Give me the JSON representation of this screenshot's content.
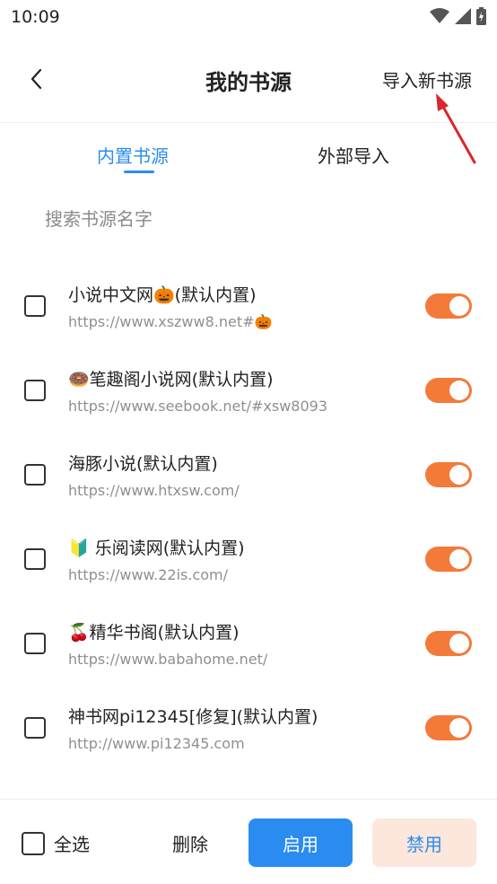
{
  "status_bar": {
    "time": "10:09"
  },
  "nav": {
    "title": "我的书源",
    "import_label": "导入新书源"
  },
  "tabs": [
    {
      "label": "内置书源"
    },
    {
      "label": "外部导入"
    }
  ],
  "search": {
    "placeholder": "搜索书源名字"
  },
  "sources": [
    {
      "name": "小说中文网🎃(默认内置)",
      "url": "https://www.xszww8.net#🎃",
      "enabled": true
    },
    {
      "name": "🍩笔趣阁小说网(默认内置)",
      "url": "https://www.seebook.net/#xsw8093",
      "enabled": true
    },
    {
      "name": "海豚小说(默认内置)",
      "url": "https://www.htxsw.com/",
      "enabled": true
    },
    {
      "name": "🔰 乐阅读网(默认内置)",
      "url": "https://www.22is.com/",
      "enabled": true
    },
    {
      "name": "🍒精华书阁(默认内置)",
      "url": "https://www.babahome.net/",
      "enabled": true
    },
    {
      "name": "神书网pi12345[修复](默认内置)",
      "url": "http://www.pi12345.com",
      "enabled": true
    }
  ],
  "bottom": {
    "select_all": "全选",
    "delete": "删除",
    "enable": "启用",
    "disable": "禁用"
  },
  "colors": {
    "accent": "#2a8cf0",
    "toggle_on": "#f47a3a",
    "disable_bg": "#fde6dc",
    "annotation_arrow": "#d9262c"
  }
}
